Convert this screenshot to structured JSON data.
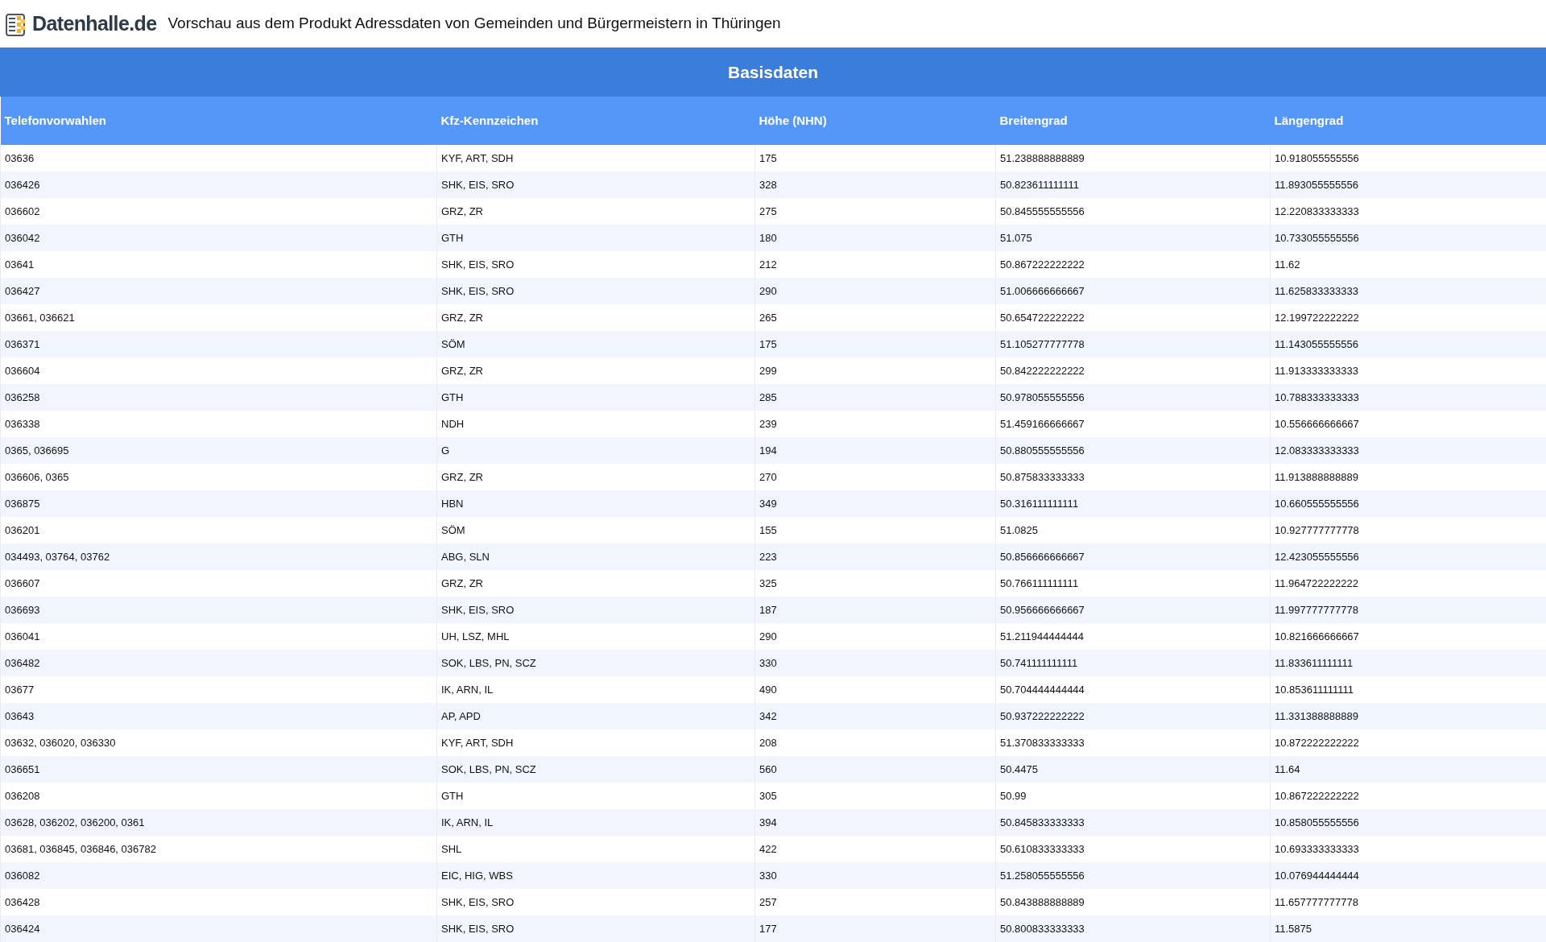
{
  "header": {
    "logo_text": "Datenhalle.de",
    "title": "Vorschau aus dem Produkt Adressdaten von Gemeinden und Bürgermeistern in Thüringen"
  },
  "section_title": "Basisdaten",
  "table": {
    "columns": [
      "Telefonvorwahlen",
      "Kfz-Kennzeichen",
      "Höhe (NHN)",
      "Breitengrad",
      "Längengrad"
    ],
    "rows": [
      [
        "03636",
        "KYF, ART, SDH",
        "175",
        "51.238888888889",
        "10.918055555556"
      ],
      [
        "036426",
        "SHK, EIS, SRO",
        "328",
        "50.823611111111",
        "11.893055555556"
      ],
      [
        "036602",
        "GRZ, ZR",
        "275",
        "50.845555555556",
        "12.220833333333"
      ],
      [
        "036042",
        "GTH",
        "180",
        "51.075",
        "10.733055555556"
      ],
      [
        "03641",
        "SHK, EIS, SRO",
        "212",
        "50.867222222222",
        "11.62"
      ],
      [
        "036427",
        "SHK, EIS, SRO",
        "290",
        "51.006666666667",
        "11.625833333333"
      ],
      [
        "03661, 036621",
        "GRZ, ZR",
        "265",
        "50.654722222222",
        "12.199722222222"
      ],
      [
        "036371",
        "SÖM",
        "175",
        "51.105277777778",
        "11.143055555556"
      ],
      [
        "036604",
        "GRZ, ZR",
        "299",
        "50.842222222222",
        "11.913333333333"
      ],
      [
        "036258",
        "GTH",
        "285",
        "50.978055555556",
        "10.788333333333"
      ],
      [
        "036338",
        "NDH",
        "239",
        "51.459166666667",
        "10.556666666667"
      ],
      [
        "0365, 036695",
        "G",
        "194",
        "50.880555555556",
        "12.083333333333"
      ],
      [
        "036606, 0365",
        "GRZ, ZR",
        "270",
        "50.875833333333",
        "11.913888888889"
      ],
      [
        "036875",
        "HBN",
        "349",
        "50.316111111111",
        "10.660555555556"
      ],
      [
        "036201",
        "SÖM",
        "155",
        "51.0825",
        "10.927777777778"
      ],
      [
        "034493, 03764, 03762",
        "ABG, SLN",
        "223",
        "50.856666666667",
        "12.423055555556"
      ],
      [
        "036607",
        "GRZ, ZR",
        "325",
        "50.766111111111",
        "11.964722222222"
      ],
      [
        "036693",
        "SHK, EIS, SRO",
        "187",
        "50.956666666667",
        "11.997777777778"
      ],
      [
        "036041",
        "UH, LSZ, MHL",
        "290",
        "51.211944444444",
        "10.821666666667"
      ],
      [
        "036482",
        "SOK, LBS, PN, SCZ",
        "330",
        "50.741111111111",
        "11.833611111111"
      ],
      [
        "03677",
        "IK, ARN, IL",
        "490",
        "50.704444444444",
        "10.853611111111"
      ],
      [
        "03643",
        "AP, APD",
        "342",
        "50.937222222222",
        "11.331388888889"
      ],
      [
        "03632, 036020, 036330",
        "KYF, ART, SDH",
        "208",
        "51.370833333333",
        "10.872222222222"
      ],
      [
        "036651",
        "SOK, LBS, PN, SCZ",
        "560",
        "50.4475",
        "11.64"
      ],
      [
        "036208",
        "GTH",
        "305",
        "50.99",
        "10.867222222222"
      ],
      [
        "03628, 036202, 036200, 0361",
        "IK, ARN, IL",
        "394",
        "50.845833333333",
        "10.858055555556"
      ],
      [
        "03681, 036845, 036846, 036782",
        "SHL",
        "422",
        "50.610833333333",
        "10.693333333333"
      ],
      [
        "036082",
        "EIC, HIG, WBS",
        "330",
        "51.258055555556",
        "10.076944444444"
      ],
      [
        "036428",
        "SHK, EIS, SRO",
        "257",
        "50.843888888889",
        "11.657777777778"
      ],
      [
        "036424",
        "SHK, EIS, SRO",
        "177",
        "50.800833333333",
        "11.5875"
      ]
    ]
  }
}
